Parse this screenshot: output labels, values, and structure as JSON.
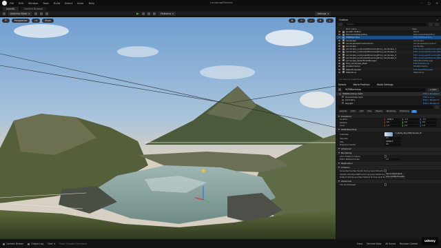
{
  "app": {
    "title": "LandscapeTutorial",
    "level_tab": "Level01",
    "cb_tab": "Content Browser"
  },
  "menu": [
    "File",
    "Edit",
    "Window",
    "Tools",
    "Build",
    "Select",
    "Actor",
    "Help"
  ],
  "toolbar": {
    "mode": "Selection Mode",
    "platforms": "Platforms",
    "settings": "Settings"
  },
  "viewport": {
    "perspective": "Perspective",
    "lit": "Lit",
    "show": "Show"
  },
  "outliner": {
    "title": "Outliner",
    "search_placeholder": "Search...",
    "col_label": "Item Label",
    "col_type": "Type",
    "rows": [
      {
        "label": "Level01 (Editor)",
        "type": "World",
        "link": false,
        "sel": false,
        "folder": false
      },
      {
        "label": "ExponentialHeightFog",
        "type": "ExponentialHeightFog",
        "link": false,
        "sel": false,
        "folder": false
      },
      {
        "label": "HDRIBackdrop",
        "type": "Edit HDRIBackdrop",
        "link": true,
        "sel": true,
        "folder": false
      },
      {
        "label": "Landscape",
        "type": "Landscape",
        "link": false,
        "sel": false,
        "folder": false
      },
      {
        "label": "LandscapeGizmoActiveActor",
        "type": "LandscapeGizmoActive",
        "link": false,
        "sel": false,
        "folder": false
      },
      {
        "label": "Landscape",
        "type": "Landscape",
        "link": false,
        "sel": false,
        "folder": true
      },
      {
        "label": "Landscape_LandscapeStreamingProxy_Landscape_1",
        "type": "Edit LandscapeStreamingProxy",
        "link": true,
        "sel": false,
        "folder": false
      },
      {
        "label": "Landscape_LandscapeStreamingProxy_Landscape_2",
        "type": "Edit LandscapeStreamingProxy",
        "link": true,
        "sel": false,
        "folder": false
      },
      {
        "label": "Landscape_LandscapeStreamingProxy_Landscape_3",
        "type": "Edit LandscapeStreamingProxy",
        "link": true,
        "sel": false,
        "folder": false
      },
      {
        "label": "Landscape_LandscapeStreamingProxy_Landscape_4",
        "type": "Edit LandscapeStreamingProxy",
        "link": true,
        "sel": false,
        "folder": false
      },
      {
        "label": "Landscape_WaterBrushManager",
        "type": "WaterBrushManager",
        "link": false,
        "sel": false,
        "folder": false
      },
      {
        "label": "PCG_Landscape_Mesh",
        "type": "Edit PCGVolume",
        "link": true,
        "sel": false,
        "folder": false
      },
      {
        "label": "PCGWorldActor",
        "type": "PCGWorldActor",
        "link": false,
        "sel": false,
        "folder": false
      },
      {
        "label": "WaterBodyLake",
        "type": "Edit WaterBodyLake",
        "link": true,
        "sel": false,
        "folder": false
      },
      {
        "label": "WaterZone",
        "type": "WaterZone",
        "link": false,
        "sel": false,
        "folder": false
      }
    ],
    "footer": "14 actors (1 selected)"
  },
  "details": {
    "tabs": [
      "Details",
      "World Partition",
      "World Settings"
    ],
    "actor_name": "HDRIBackdrop",
    "add_label": "+ Add",
    "components": [
      {
        "label": "HDRIBackdrop (Self)",
        "edit": "Edit in Blueprint"
      },
      {
        "label": "SceneComponent",
        "edit": "Edit in C++"
      },
      {
        "label": "Geometry",
        "edit": "Edit in Blueprint"
      },
      {
        "label": "Skylight",
        "edit": "Edit in Blueprint"
      }
    ],
    "filters": [
      "General",
      "Actor",
      "LOD",
      "Misc",
      "Physics",
      "Rendering",
      "Streaming",
      "All"
    ],
    "sections": {
      "transform": "Transform",
      "hdri": "HDRI Backdrop",
      "advanced": "Advanced",
      "rendering": "Rendering",
      "replication": "Replication",
      "collision": "Collision"
    },
    "transform": [
      {
        "label": "Location",
        "x": "-1566.0",
        "y": "-7.4",
        "z": "-7.0"
      },
      {
        "label": "Rotation",
        "x": "0.0",
        "y": "0.0",
        "z": "0.0"
      },
      {
        "label": "Scale",
        "x": "1.0",
        "y": "1.0",
        "z": "1.0"
      }
    ],
    "hdri": [
      {
        "label": "Cubemap",
        "value": "T_Ready_Sky_HDRI_Sunset_4K"
      },
      {
        "label": "Intensity",
        "value": "2.5"
      },
      {
        "label": "Size",
        "value": "16000.0"
      },
      {
        "label": "Projection Center",
        "value": "0.0"
      }
    ],
    "rendering": [
      {
        "label": "Actor Hidden In Game",
        "value": ""
      },
      {
        "label": "Editor Billboard Scale",
        "value": "1.0"
      }
    ],
    "collision": [
      {
        "label": "Generate Overlap Events During Level Streaming",
        "value": ""
      },
      {
        "label": "Update Overlaps Method During Level Streaming",
        "value": "Use Config Default"
      },
      {
        "label": "Default Update Overlaps Method During Level St",
        "value": "Only Update Movable"
      }
    ],
    "advanced2": "Advanced",
    "can_be_damaged": "Can be Damaged"
  },
  "statusbar": {
    "items": [
      "Content Drawer",
      "Output Log",
      "Cmd",
      "Enter Console Command"
    ],
    "right": [
      "Trace",
      "Derived Data",
      "All Saved",
      "Revision Control"
    ]
  },
  "watermark": "udemy",
  "colors": {
    "accent": "#2f7bd8",
    "selection": "#1e4f82",
    "link": "#4da3ff"
  }
}
